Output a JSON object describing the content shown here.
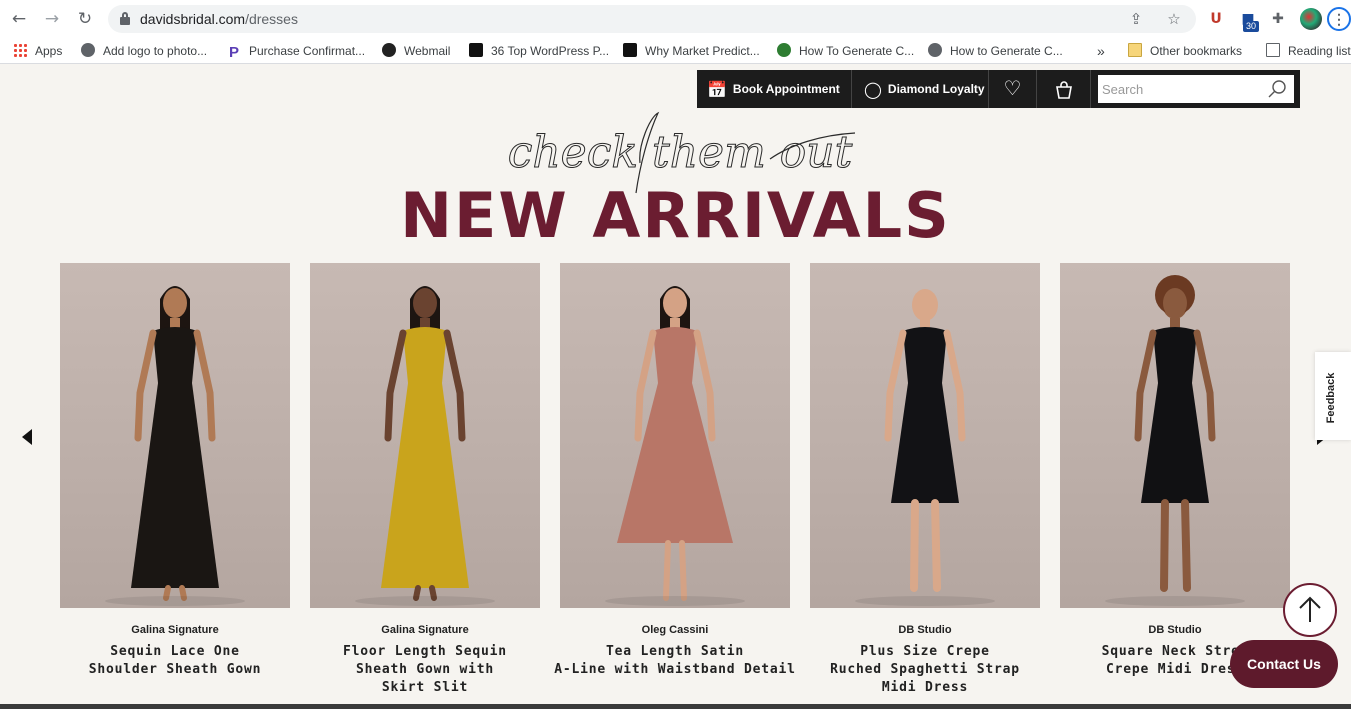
{
  "browser": {
    "url_host": "davidsbridal.com",
    "url_path": "/dresses",
    "extension_badge": "30",
    "bookmarks": [
      {
        "label": "Apps",
        "icon": "apps-grid-icon"
      },
      {
        "label": "Add logo to photo...",
        "icon": "globe-icon"
      },
      {
        "label": "Purchase Confirmat...",
        "icon": "paypal-icon"
      },
      {
        "label": "Webmail",
        "icon": "webmail-icon"
      },
      {
        "label": "36 Top WordPress P...",
        "icon": "paw-icon"
      },
      {
        "label": "Why Market Predict...",
        "icon": "medium-icon"
      },
      {
        "label": "How To Generate C...",
        "icon": "pin-icon"
      },
      {
        "label": "How to Generate C...",
        "icon": "globe-icon"
      }
    ],
    "overflow": "»",
    "other_bookmarks": "Other bookmarks",
    "reading_list": "Reading list"
  },
  "utility": {
    "book_appointment": "Book Appointment",
    "diamond_loyalty": "Diamond Loyalty",
    "search_placeholder": "Search"
  },
  "hero": {
    "script_text": "check them out",
    "headline": "NEW ARRIVALS"
  },
  "products": [
    {
      "brand": "Galina Signature",
      "title_lines": [
        "Sequin Lace One",
        "Shoulder Sheath Gown"
      ],
      "dress_color": "#1a1613",
      "skin": "#b07a55"
    },
    {
      "brand": "Galina Signature",
      "title_lines": [
        "Floor Length Sequin",
        "Sheath Gown with",
        "Skirt Slit"
      ],
      "dress_color": "#c9a41c",
      "skin": "#6a4330"
    },
    {
      "brand": "Oleg Cassini",
      "title_lines": [
        "Tea Length Satin",
        "A-Line with Waistband Detail"
      ],
      "dress_color": "#b87667",
      "skin": "#d4a285"
    },
    {
      "brand": "DB Studio",
      "title_lines": [
        "Plus Size Crepe",
        "Ruched Spaghetti Strap",
        "Midi Dress"
      ],
      "dress_color": "#121215",
      "skin": "#d9a88a"
    },
    {
      "brand": "DB Studio",
      "title_lines": [
        "Square Neck Stret",
        "Crepe Midi Dress"
      ],
      "dress_color": "#111113",
      "skin": "#8a5a3e"
    }
  ],
  "feedback": "Feedback",
  "contact": "Contact Us",
  "colors": {
    "brand": "#6b1d31",
    "utility_bar": "#1c1c1c",
    "background": "#f6f4f0"
  }
}
